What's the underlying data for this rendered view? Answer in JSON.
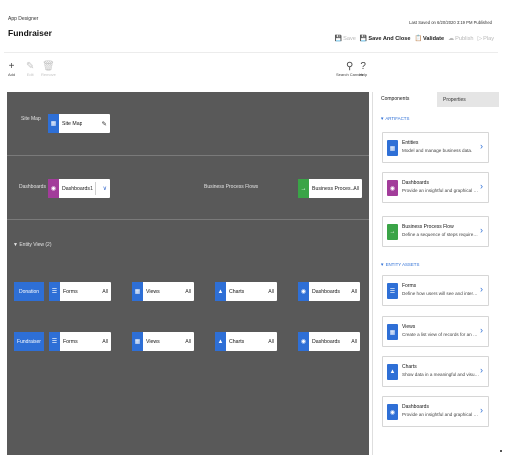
{
  "header": {
    "app_name": "App Designer",
    "title": "Fundraiser",
    "save_status": "Last Saved on 6/20/2020 3:19 PM Published",
    "actions": [
      {
        "label": "Save",
        "icon": "save-icon",
        "enabled": false
      },
      {
        "label": "Save And Close",
        "icon": "save-close-icon",
        "enabled": true
      },
      {
        "label": "Validate",
        "icon": "validate-icon",
        "enabled": true
      },
      {
        "label": "Publish",
        "icon": "publish-icon",
        "enabled": false
      },
      {
        "label": "Play",
        "icon": "play-icon",
        "enabled": false
      }
    ]
  },
  "toolbar": {
    "add": "Add",
    "edit": "Edit",
    "remove": "Remove",
    "search": "Search Canvas",
    "help": "Help"
  },
  "canvas": {
    "sitemap": {
      "section_label": "Site Map",
      "tile_label": "Site Map"
    },
    "dashboards": {
      "section_label": "Dashboards",
      "tile_label": "Dashboards",
      "count": "1"
    },
    "bpf": {
      "section_label": "Business Process Flows",
      "tile_label": "Business Proces...",
      "count": "All"
    },
    "entity_view_label": "Entity View (2)",
    "entities": [
      {
        "name": "Donation",
        "tiles": [
          {
            "label": "Forms",
            "count": "All"
          },
          {
            "label": "Views",
            "count": "All"
          },
          {
            "label": "Charts",
            "count": "All"
          },
          {
            "label": "Dashboards",
            "count": "All"
          }
        ]
      },
      {
        "name": "Fundraiser",
        "tiles": [
          {
            "label": "Forms",
            "count": "All"
          },
          {
            "label": "Views",
            "count": "All"
          },
          {
            "label": "Charts",
            "count": "All"
          },
          {
            "label": "Dashboards",
            "count": "All"
          }
        ]
      }
    ]
  },
  "panel": {
    "tabs": [
      "Components",
      "Properties"
    ],
    "artifacts_head": "▼ ARTIFACTS",
    "entity_assets_head": "▼ ENTITY ASSETS",
    "artifacts": [
      {
        "title": "Entities",
        "desc": "Model and manage business data.",
        "icon": "entities-icon",
        "color": "#2e6fd6"
      },
      {
        "title": "Dashboards",
        "desc": "Provide an insightful and graphical overv...",
        "icon": "dashboards-icon",
        "color": "#a23c9a"
      },
      {
        "title": "Business Process Flow",
        "desc": "Define a sequence of steps required to c...",
        "icon": "process-flow-icon",
        "color": "#3aa447"
      }
    ],
    "entity_assets": [
      {
        "title": "Forms",
        "desc": "Define how users will see and interact wi...",
        "icon": "forms-icon",
        "color": "#2e6fd6"
      },
      {
        "title": "Views",
        "desc": "Create a list view of records for an entity.",
        "icon": "views-icon",
        "color": "#2e6fd6"
      },
      {
        "title": "Charts",
        "desc": "Show data in a meaningful and visual re...",
        "icon": "charts-icon",
        "color": "#2e6fd6"
      },
      {
        "title": "Dashboards",
        "desc": "Provide an insightful and graphical overv...",
        "icon": "dashboards-icon",
        "color": "#2e6fd6"
      }
    ]
  },
  "colors": {
    "accent": "#2e6fd6",
    "dashboards": "#a23c9a",
    "process_flow": "#3aa447",
    "canvas": "#595959"
  }
}
